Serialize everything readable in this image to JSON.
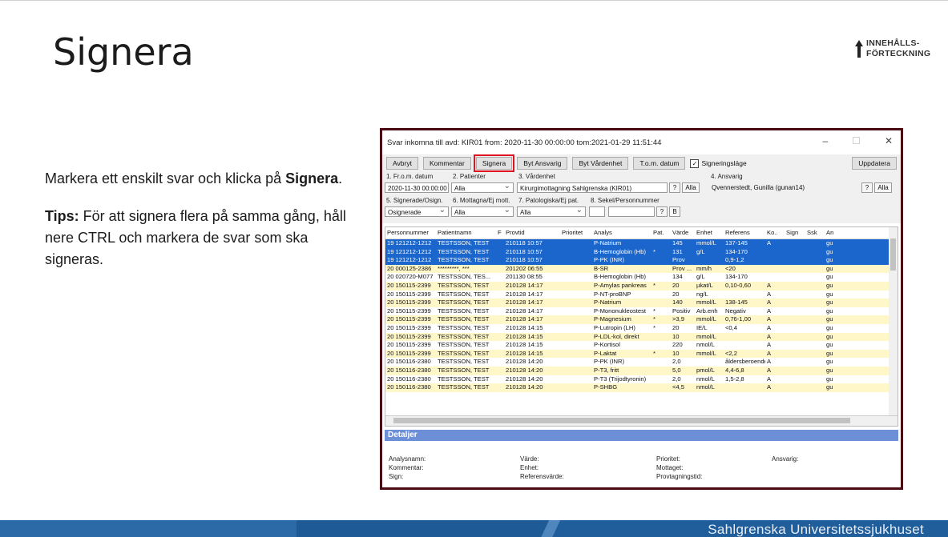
{
  "slide": {
    "title": "Signera",
    "toc_line1": "INNEHÅLLS-",
    "toc_line2": "FÖRTECKNING",
    "instruction_pre": "Markera ett enskilt svar och klicka på ",
    "instruction_bold": "Signera",
    "instruction_post": ".",
    "tips_label": "Tips:",
    "tips_text": " För att signera flera på samma gång, håll nere CTRL och markera de svar som ska signeras.",
    "footer_brand": "Sahlgrenska Universitetssjukhuset"
  },
  "window": {
    "title": "Svar inkomna till avd: KIR01 from: 2020-11-30 00:00:00 tom:2021-01-29 11:51:44",
    "minimize": "–",
    "maximize": "☐",
    "close": "✕"
  },
  "toolbar": {
    "avbryt": "Avbryt",
    "kommentar": "Kommentar",
    "signera": "Signera",
    "byt_ansvarig": "Byt Ansvarig",
    "byt_vardenhet": "Byt Vårdenhet",
    "tom_datum": "T.o.m. datum",
    "signeringslage": "Signeringsläge",
    "uppdatera": "Uppdatera"
  },
  "filters": {
    "l1": "1. Fr.o.m. datum",
    "v1": "2020-11-30 00:00:00",
    "l2": "2. Patienter",
    "v2": "Alla",
    "l3": "3. Vårdenhet",
    "v3": "Kirurgimottagning Sahlgrenska (KIR01)",
    "q3": "?",
    "a3": "Alla",
    "l4": "4. Ansvarig",
    "v4": "Qvennerstedt, Gunilla (gunan14)",
    "q4": "?",
    "a4": "Alla",
    "l5": "5. Signerade/Osign.",
    "v5": "Osignerade",
    "l6": "6. Mottagna/Ej mott.",
    "v6": "Alla",
    "l7": "7. Patologiska/Ej pat.",
    "v7": "Alla",
    "l8": "8. Sekel/Personnummer",
    "q8": "?",
    "b8": "B"
  },
  "grid": {
    "headers": [
      "Personnummer",
      "Patientnamn",
      "F",
      "Provtid",
      "Prioritet",
      "Analys",
      "Pat.",
      "Värde",
      "Enhet",
      "Referens",
      "Ko..",
      "Sign",
      "Ssk",
      "An"
    ],
    "rows": [
      {
        "s": "sel",
        "c": [
          "19 121212-1212",
          "TESTSSON, TEST",
          "",
          "210118 10:57",
          "",
          "P-Natrium",
          "",
          "145",
          "mmol/L",
          "137-145",
          "A",
          "",
          "",
          "gu"
        ]
      },
      {
        "s": "sel",
        "c": [
          "19 121212-1212",
          "TESTSSON, TEST",
          "",
          "210118 10:57",
          "",
          "B-Hemoglobin (Hb)",
          "*",
          "131",
          "g/L",
          "134-170",
          "",
          "",
          "",
          "gu"
        ]
      },
      {
        "s": "sel",
        "c": [
          "19 121212-1212",
          "TESTSSON, TEST",
          "",
          "210118 10:57",
          "",
          "P-PK (INR)",
          "",
          "Prov",
          "",
          "0,9-1,2",
          "",
          "",
          "",
          "gu"
        ]
      },
      {
        "s": "yel",
        "c": [
          "20 000125-2386",
          "*********, ***",
          "",
          "201202 06:55",
          "",
          "B-SR",
          "",
          "Prov ...",
          "mm/h",
          "<20",
          "",
          "",
          "",
          "gu"
        ]
      },
      {
        "s": "wht",
        "c": [
          "20 020720-M077",
          "TESTSSON, TES...",
          "",
          "201130 08:55",
          "",
          "B-Hemoglobin (Hb)",
          "",
          "134",
          "g/L",
          "134-170",
          "",
          "",
          "",
          "gu"
        ]
      },
      {
        "s": "yel",
        "c": [
          "20 150115-2399",
          "TESTSSON, TEST",
          "",
          "210128 14:17",
          "",
          "P-Amylas pankreas",
          "*",
          "20",
          "µkat/L",
          "0,10-0,60",
          "A",
          "",
          "",
          "gu"
        ]
      },
      {
        "s": "wht",
        "c": [
          "20 150115-2399",
          "TESTSSON, TEST",
          "",
          "210128 14:17",
          "",
          "P-NT-proBNP",
          "",
          "20",
          "ng/L",
          "",
          "A",
          "",
          "",
          "gu"
        ]
      },
      {
        "s": "yel",
        "c": [
          "20 150115-2399",
          "TESTSSON, TEST",
          "",
          "210128 14:17",
          "",
          "P-Natrium",
          "",
          "140",
          "mmol/L",
          "138-145",
          "A",
          "",
          "",
          "gu"
        ]
      },
      {
        "s": "wht",
        "c": [
          "20 150115-2399",
          "TESTSSON, TEST",
          "",
          "210128 14:17",
          "",
          "P-Mononukleostest",
          "*",
          "Positiv",
          "Arb.enh",
          "Negativ",
          "A",
          "",
          "",
          "gu"
        ]
      },
      {
        "s": "yel",
        "c": [
          "20 150115-2399",
          "TESTSSON, TEST",
          "",
          "210128 14:17",
          "",
          "P-Magnesium",
          "*",
          ">3,9",
          "mmol/L",
          "0,76-1,00",
          "A",
          "",
          "",
          "gu"
        ]
      },
      {
        "s": "wht",
        "c": [
          "20 150115-2399",
          "TESTSSON, TEST",
          "",
          "210128 14:15",
          "",
          "P-Lutropin (LH)",
          "*",
          "20",
          "IE/L",
          "<0,4",
          "A",
          "",
          "",
          "gu"
        ]
      },
      {
        "s": "yel",
        "c": [
          "20 150115-2399",
          "TESTSSON, TEST",
          "",
          "210128 14:15",
          "",
          "P-LDL-kol, direkt",
          "",
          "10",
          "mmol/L",
          "",
          "A",
          "",
          "",
          "gu"
        ]
      },
      {
        "s": "wht",
        "c": [
          "20 150115-2399",
          "TESTSSON, TEST",
          "",
          "210128 14:15",
          "",
          "P-Kortisol",
          "",
          "220",
          "nmol/L",
          "",
          "A",
          "",
          "",
          "gu"
        ]
      },
      {
        "s": "yel",
        "c": [
          "20 150115-2399",
          "TESTSSON, TEST",
          "",
          "210128 14:15",
          "",
          "P-Laktat",
          "*",
          "10",
          "mmol/L",
          "<2,2",
          "A",
          "",
          "",
          "gu"
        ]
      },
      {
        "s": "wht",
        "c": [
          "20 150116-2380",
          "TESTSSON, TEST",
          "",
          "210128 14:20",
          "",
          "P-PK (INR)",
          "",
          "2,0",
          "",
          "åldersberoende",
          "A",
          "",
          "",
          "gu"
        ]
      },
      {
        "s": "yel",
        "c": [
          "20 150116-2380",
          "TESTSSON, TEST",
          "",
          "210128 14:20",
          "",
          "P-T3, fritt",
          "",
          "5,0",
          "pmol/L",
          "4,4-6,8",
          "A",
          "",
          "",
          "gu"
        ]
      },
      {
        "s": "wht",
        "c": [
          "20 150116-2380",
          "TESTSSON, TEST",
          "",
          "210128 14:20",
          "",
          "P-T3 (Trijodtyronin)",
          "",
          "2,0",
          "nmol/L",
          "1,5-2,8",
          "A",
          "",
          "",
          "gu"
        ]
      },
      {
        "s": "yel",
        "c": [
          "20 150116-2380",
          "TESTSSON, TEST",
          "",
          "210128 14:20",
          "",
          "P-SHBG",
          "",
          "<4,5",
          "nmol/L",
          "",
          "A",
          "",
          "",
          "gu"
        ]
      }
    ]
  },
  "details": {
    "heading": "Detaljer",
    "analysnamn": "Analysnamn:",
    "kommentar": "Kommentar:",
    "sign": "Sign:",
    "varde": "Värde:",
    "enhet": "Enhet:",
    "referensvarde": "Referensvärde:",
    "prioritet": "Prioritet:",
    "mottaget": "Mottaget:",
    "provtagningstid": "Provtagningstid:",
    "ansvarig": "Ansvarig:"
  }
}
